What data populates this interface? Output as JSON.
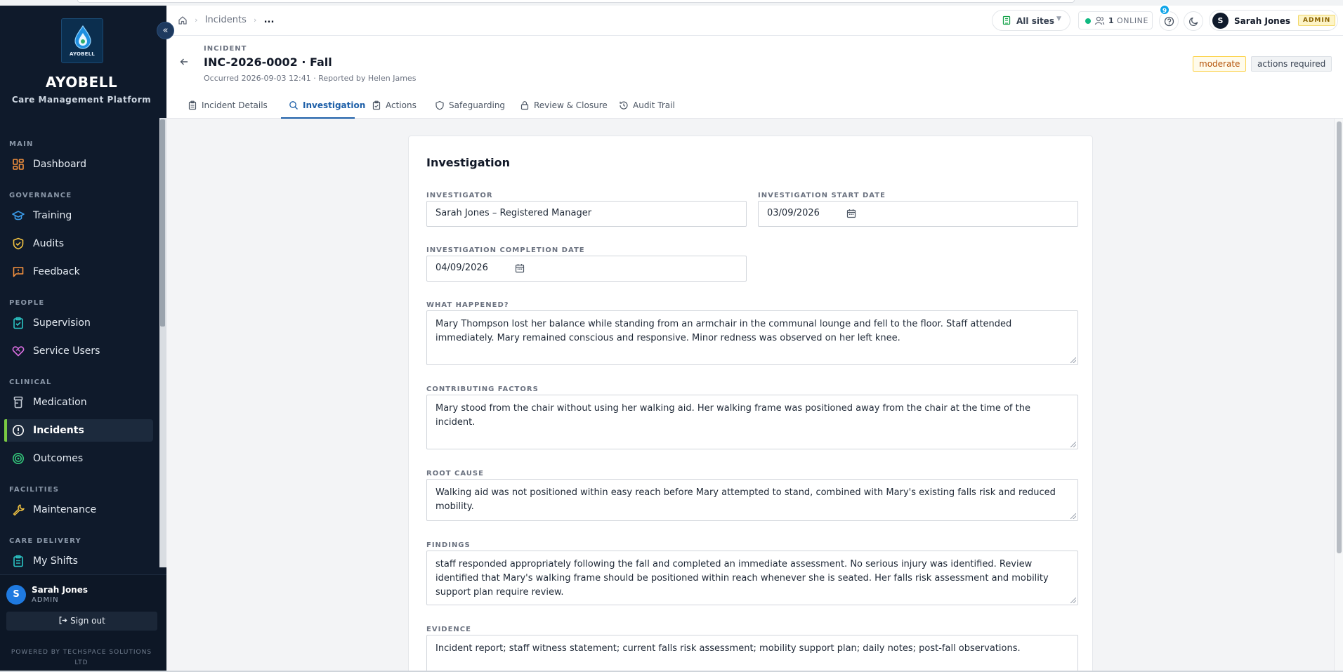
{
  "brand": {
    "logo_text": "AYOBELL",
    "title": "AYOBELL",
    "subtitle": "Care Management Platform"
  },
  "sidebar": {
    "sections": [
      {
        "label": "MAIN"
      },
      {
        "label": "GOVERNANCE"
      },
      {
        "label": "PEOPLE"
      },
      {
        "label": "CLINICAL"
      },
      {
        "label": "FACILITIES"
      },
      {
        "label": "CARE DELIVERY"
      }
    ],
    "items": [
      {
        "label": "Dashboard",
        "icon": "dashboard-icon",
        "color": "#f5913e"
      },
      {
        "label": "Training",
        "icon": "graduation-cap-icon",
        "color": "#3b9be8"
      },
      {
        "label": "Audits",
        "icon": "shield-check-icon",
        "color": "#f5c542"
      },
      {
        "label": "Feedback",
        "icon": "message-square-icon",
        "color": "#f5913e"
      },
      {
        "label": "Supervision",
        "icon": "clipboard-check-icon",
        "color": "#2bc4c4"
      },
      {
        "label": "Service Users",
        "icon": "heart-handshake-icon",
        "color": "#d96ee0"
      },
      {
        "label": "Medication",
        "icon": "pill-bottle-icon",
        "color": "#c2c9d3"
      },
      {
        "label": "Incidents",
        "icon": "alert-circle-icon",
        "color": "#ffffff"
      },
      {
        "label": "Outcomes",
        "icon": "target-icon",
        "color": "#34c77b"
      },
      {
        "label": "Maintenance",
        "icon": "wrench-icon",
        "color": "#f5c542"
      },
      {
        "label": "My Shifts",
        "icon": "clipboard-list-icon",
        "color": "#2bc4c4"
      }
    ],
    "active_item": "Incidents",
    "active_accent": "#7ac943",
    "user": {
      "initial": "S",
      "name": "Sarah Jones",
      "role": "ADMIN"
    },
    "signout_label": "Sign out",
    "powered_by": "POWERED BY TECHSPACE SOLUTIONS LTD"
  },
  "topbar": {
    "breadcrumb": [
      "Incidents",
      "..."
    ],
    "site_select": "All sites",
    "online_count": "1",
    "online_label": "ONLINE",
    "notification_count": "9",
    "user": {
      "initial": "S",
      "name": "Sarah Jones",
      "role": "ADMIN"
    }
  },
  "header": {
    "kicker": "INCIDENT",
    "title": "INC-2026-0002 · Fall",
    "meta": "Occurred 2026-09-03 12:41 · Reported by Helen James",
    "badges": {
      "severity": "moderate",
      "status": "actions required"
    },
    "tabs": [
      {
        "label": "Incident Details",
        "icon": "clipboard-icon"
      },
      {
        "label": "Investigation",
        "icon": "search-icon"
      },
      {
        "label": "Actions",
        "icon": "clipboard-check-icon"
      },
      {
        "label": "Safeguarding",
        "icon": "shield-icon"
      },
      {
        "label": "Review & Closure",
        "icon": "lock-icon"
      },
      {
        "label": "Audit Trail",
        "icon": "history-icon"
      }
    ],
    "active_tab": "Investigation"
  },
  "investigation": {
    "title": "Investigation",
    "investigator": {
      "label": "INVESTIGATOR",
      "value": "Sarah Jones – Registered Manager"
    },
    "start_date": {
      "label": "INVESTIGATION START DATE",
      "value": "03/09/2026"
    },
    "completion_date": {
      "label": "INVESTIGATION COMPLETION DATE",
      "value": "04/09/2026"
    },
    "what_happened": {
      "label": "WHAT HAPPENED?",
      "value": "Mary Thompson lost her balance while standing from an armchair in the communal lounge and fell to the floor. Staff attended immediately. Mary remained conscious and responsive. Minor redness was observed on her left knee."
    },
    "contributing_factors": {
      "label": "CONTRIBUTING FACTORS",
      "value": "Mary stood from the chair without using her walking aid. Her walking frame was positioned away from the chair at the time of the incident."
    },
    "root_cause": {
      "label": "ROOT CAUSE",
      "value": "Walking aid was not positioned within easy reach before Mary attempted to stand, combined with Mary's existing falls risk and reduced mobility."
    },
    "findings": {
      "label": "FINDINGS",
      "value": "staff responded appropriately following the fall and completed an immediate assessment. No serious injury was identified. Review identified that Mary's walking frame should be positioned within reach whenever she is seated. Her falls risk assessment and mobility support plan require review."
    },
    "evidence": {
      "label": "EVIDENCE",
      "value": "Incident report; staff witness statement; current falls risk assessment; mobility support plan; daily notes; post-fall observations."
    }
  }
}
